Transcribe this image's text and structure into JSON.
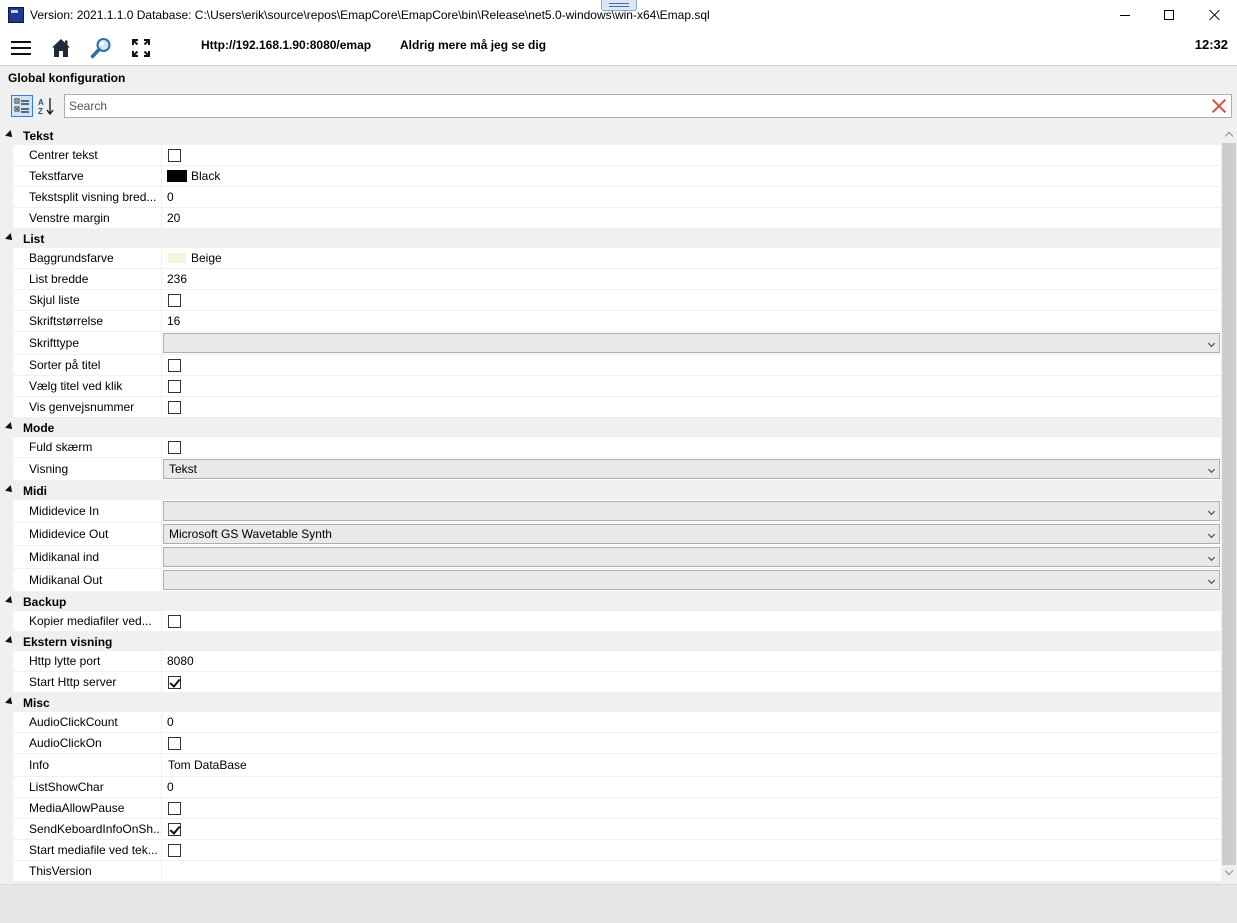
{
  "window": {
    "title": "Version: 2021.1.1.0 Database: C:\\Users\\erik\\source\\repos\\EmapCore\\EmapCore\\bin\\Release\\net5.0-windows\\win-x64\\Emap.sql",
    "logo_icon": "emap-app-icon"
  },
  "toolbar": {
    "url": "Http://192.168.1.90:8080/emap",
    "song_title": "Aldrig mere må jeg se dig",
    "clock": "12:32",
    "icons": [
      "hamburger-menu-icon",
      "home-icon",
      "magnifier-icon",
      "fullscreen-icon"
    ]
  },
  "panel": {
    "title": "Global konfiguration",
    "search_placeholder": "Search"
  },
  "categories": [
    {
      "name": "Tekst",
      "props": [
        {
          "label": "Centrer tekst",
          "type": "checkbox",
          "checked": false
        },
        {
          "label": "Tekstfarve",
          "type": "color",
          "value": "Black",
          "color": "#000000"
        },
        {
          "label": "Tekstsplit visning bred...",
          "type": "text",
          "value": "0"
        },
        {
          "label": "Venstre margin",
          "type": "text",
          "value": "20"
        }
      ]
    },
    {
      "name": "List",
      "props": [
        {
          "label": "Baggrundsfarve",
          "type": "color",
          "value": "Beige",
          "color": "#f5f5dc"
        },
        {
          "label": "List bredde",
          "type": "text",
          "value": "236"
        },
        {
          "label": "Skjul liste",
          "type": "checkbox",
          "checked": false
        },
        {
          "label": "Skriftstørrelse",
          "type": "text",
          "value": "16"
        },
        {
          "label": "Skrifttype",
          "type": "combo",
          "value": ""
        },
        {
          "label": "Sorter på titel",
          "type": "checkbox",
          "checked": false
        },
        {
          "label": "Vælg titel ved klik",
          "type": "checkbox",
          "checked": false
        },
        {
          "label": "Vis genvejsnummer",
          "type": "checkbox",
          "checked": false
        }
      ]
    },
    {
      "name": "Mode",
      "props": [
        {
          "label": "Fuld skærm",
          "type": "checkbox",
          "checked": false
        },
        {
          "label": "Visning",
          "type": "combo",
          "value": "Tekst"
        }
      ]
    },
    {
      "name": "Midi",
      "props": [
        {
          "label": "Mididevice In",
          "type": "combo",
          "value": ""
        },
        {
          "label": "Mididevice Out",
          "type": "combo",
          "value": "Microsoft GS Wavetable Synth"
        },
        {
          "label": "Midikanal ind",
          "type": "combo",
          "value": ""
        },
        {
          "label": "Midikanal Out",
          "type": "combo",
          "value": ""
        }
      ]
    },
    {
      "name": "Backup",
      "props": [
        {
          "label": "Kopier mediafiler ved...",
          "type": "checkbox",
          "checked": false
        }
      ]
    },
    {
      "name": "Ekstern visning",
      "props": [
        {
          "label": "Http lytte port",
          "type": "text",
          "value": "8080"
        },
        {
          "label": "Start Http server",
          "type": "checkbox",
          "checked": true
        }
      ]
    },
    {
      "name": "Misc",
      "props": [
        {
          "label": "AudioClickCount",
          "type": "text",
          "value": "0"
        },
        {
          "label": "AudioClickOn",
          "type": "checkbox",
          "checked": false
        },
        {
          "label": "Info",
          "type": "textbox",
          "value": "Tom DataBase"
        },
        {
          "label": "ListShowChar",
          "type": "text",
          "value": "0"
        },
        {
          "label": "MediaAllowPause",
          "type": "checkbox",
          "checked": false
        },
        {
          "label": "SendKeboardInfoOnSh...",
          "type": "checkbox",
          "checked": true
        },
        {
          "label": "Start mediafile ved tek...",
          "type": "checkbox",
          "checked": false
        },
        {
          "label": "ThisVersion",
          "type": "text",
          "value": ""
        }
      ]
    }
  ]
}
